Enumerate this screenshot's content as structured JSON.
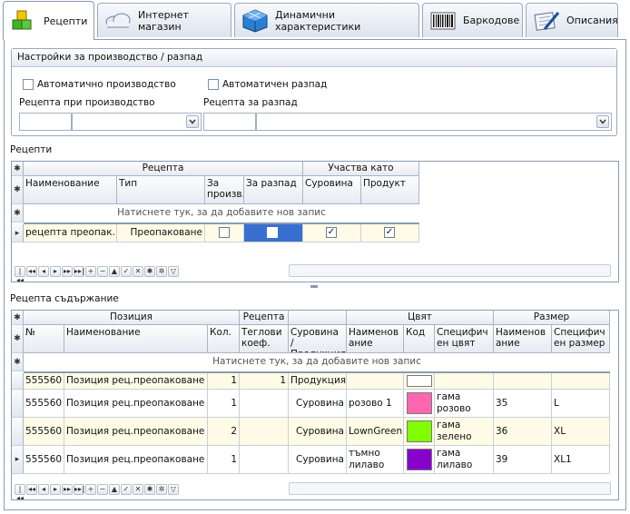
{
  "tabs": [
    {
      "label": "Рецепти",
      "icon": "cubes-icon",
      "active": true
    },
    {
      "label": "Интернет магазин",
      "icon": "cloud-icon",
      "active": false
    },
    {
      "label": "Динамични характеристики",
      "icon": "cube-grid-icon",
      "active": false
    },
    {
      "label": "Баркодове",
      "icon": "barcode-icon",
      "active": false
    },
    {
      "label": "Описания",
      "icon": "notebook-pen-icon",
      "active": false
    }
  ],
  "settings": {
    "title": "Настройки за производство / разпад",
    "auto_production": "Автоматично производство",
    "auto_breakdown": "Автоматичен разпад",
    "recipe_production_label": "Рецепта при производство",
    "recipe_breakdown_label": "Рецепта за разпад"
  },
  "recipes": {
    "title": "Рецепти",
    "group_recipe": "Рецепта",
    "group_participates": "Участва като",
    "col_name": "Наименование",
    "col_type": "Тип",
    "col_for_prod": "За произв.",
    "col_for_break": "За разпад",
    "col_raw": "Суровина",
    "col_product": "Продукт",
    "new_record": "Натиснете тук, за да добавите нов запис",
    "rows": [
      {
        "name": "рецепта преопак.",
        "type": "Преопаковане",
        "for_prod": false,
        "for_break": false,
        "raw": true,
        "product": true
      }
    ]
  },
  "content": {
    "title": "Рецепта съдържание",
    "group_position": "Позиция",
    "group_recipe": "Рецепта",
    "group_color": "Цвят",
    "group_size": "Размер",
    "col_no": "№",
    "col_name": "Наименование",
    "col_qty": "Кол.",
    "col_weight": "Теглови коеф.",
    "col_raw_product": "Суровина / Продукция",
    "col_color_name": "Наименование",
    "col_color_code": "Код",
    "col_color_spec": "Специфичен цвят",
    "col_size_name": "Наименование",
    "col_size_spec": "Специфичен размер",
    "new_record": "Натиснете тук, за да добавите нов запис",
    "rows": [
      {
        "no": "555560",
        "name": "Позиция рец.преопаковане",
        "qty": "1",
        "weight": "1",
        "kind": "Продукция",
        "color_name": "",
        "color_code": "#ffffff",
        "color_spec": "",
        "size_name": "",
        "size_spec": ""
      },
      {
        "no": "555560",
        "name": "Позиция рец.преопаковане",
        "qty": "1",
        "weight": "",
        "kind": "Суровина",
        "color_name": "розово 1",
        "color_code": "#ff66b2",
        "color_spec": "гама розово",
        "size_name": "35",
        "size_spec": "L"
      },
      {
        "no": "555560",
        "name": "Позиция рец.преопаковане",
        "qty": "2",
        "weight": "",
        "kind": "Суровина",
        "color_name": "LownGreen",
        "color_code": "#80ff00",
        "color_spec": "гама зелено",
        "size_name": "36",
        "size_spec": "XL"
      },
      {
        "no": "555560",
        "name": "Позиция рец.преопаковане",
        "qty": "1",
        "weight": "",
        "kind": "Суровина",
        "color_name": "тъмно лилаво",
        "color_code": "#8800cc",
        "color_spec": "гама лилаво",
        "size_name": "39",
        "size_spec": "XL1"
      }
    ]
  },
  "navigator": [
    "|◂◂",
    "◂◂",
    "◂",
    "▸",
    "▸▸",
    "▸▸|",
    "+",
    "−",
    "▲",
    "✓",
    "✕",
    "✱",
    "✲",
    "▽"
  ]
}
